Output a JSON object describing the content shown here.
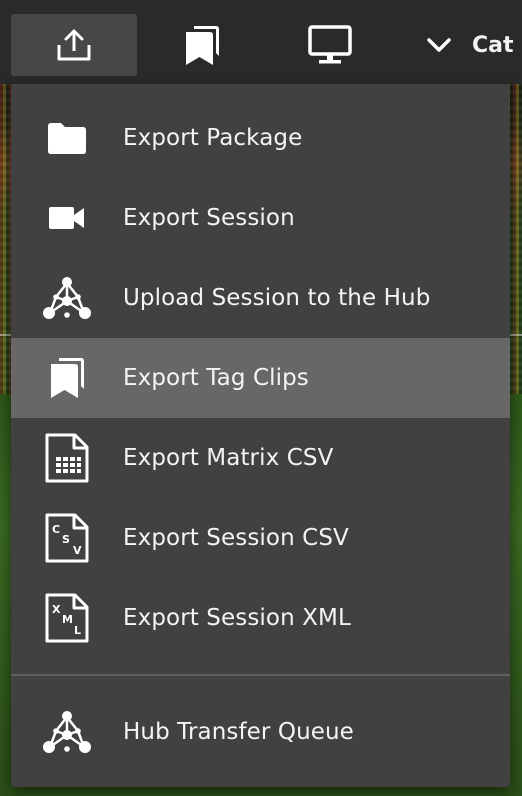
{
  "toolbar": {
    "category_label": "Cat"
  },
  "icons": {
    "export": "upload-icon",
    "tag_clips": "bookmarks-icon",
    "display": "monitor-icon",
    "category_toggle": "chevron-down-icon"
  },
  "menu": {
    "items": [
      {
        "label": "Export Package",
        "icon": "folder-icon"
      },
      {
        "label": "Export Session",
        "icon": "video-camera-icon"
      },
      {
        "label": "Upload Session to the Hub",
        "icon": "hub-network-icon"
      },
      {
        "label": "Export Tag Clips",
        "icon": "bookmarks-icon",
        "highlighted": true
      },
      {
        "label": "Export Matrix CSV",
        "icon": "matrix-csv-file-icon"
      },
      {
        "label": "Export Session CSV",
        "icon": "csv-file-icon"
      },
      {
        "label": "Export Session XML",
        "icon": "xml-file-icon"
      }
    ],
    "footer_items": [
      {
        "label": "Hub Transfer Queue",
        "icon": "hub-network-icon"
      }
    ]
  },
  "colors": {
    "toolbar_bg": "#2a2a2a",
    "active_button_bg": "#474747",
    "menu_bg": "#414141",
    "highlight_bg": "#676767",
    "text": "#f4f4f4"
  }
}
